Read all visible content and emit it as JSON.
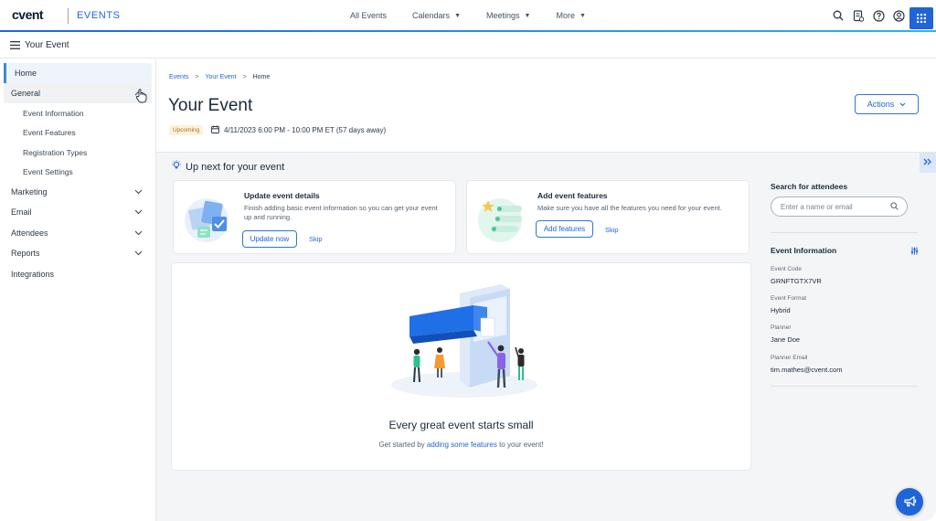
{
  "app": {
    "brand": "cvent",
    "product": "EVENTS"
  },
  "topnav": {
    "links": [
      {
        "label": "All Events",
        "dropdown": false
      },
      {
        "label": "Calendars",
        "dropdown": true
      },
      {
        "label": "Meetings",
        "dropdown": true
      },
      {
        "label": "More",
        "dropdown": true
      }
    ],
    "icons": [
      "search-icon",
      "document-icon",
      "help-icon",
      "user-icon",
      "app-grid-icon"
    ]
  },
  "subheader": {
    "title": "Your Event"
  },
  "sidebar": {
    "items": [
      {
        "label": "Home",
        "active": true
      },
      {
        "label": "General",
        "expanded": true
      },
      {
        "label": "Marketing",
        "expandable": true
      },
      {
        "label": "Email",
        "expandable": true
      },
      {
        "label": "Attendees",
        "expandable": true
      },
      {
        "label": "Reports",
        "expandable": true
      },
      {
        "label": "Integrations"
      }
    ],
    "general_children": [
      "Event Information",
      "Event Features",
      "Registration Types",
      "Event Settings"
    ]
  },
  "breadcrumb": {
    "items": [
      "Events",
      "Your Event",
      "Home"
    ]
  },
  "event": {
    "title": "Your Event",
    "status": "Upcoming",
    "datetime": "4/11/2023 6:00 PM - 10:00 PM ET (57 days away)"
  },
  "actions": {
    "label": "Actions"
  },
  "upnext": {
    "title": "Up next for your event"
  },
  "cards": [
    {
      "title": "Update event details",
      "description": "Finish adding basic event information so you can get your event up and running.",
      "button": "Update now",
      "skip": "Skip"
    },
    {
      "title": "Add event features",
      "description": "Make sure you have all the features you need for your event.",
      "button": "Add features",
      "skip": "Skip"
    }
  ],
  "empty_state": {
    "title": "Every great event starts small",
    "sub_before": "Get started by ",
    "sub_link": "adding some features",
    "sub_after": " to your event!"
  },
  "right_panel": {
    "search_label": "Search for attendees",
    "search_placeholder": "Enter a name or email",
    "info_title": "Event Information",
    "fields": [
      {
        "label": "Event Code",
        "value": "GRNFTGTX7VR"
      },
      {
        "label": "Event Format",
        "value": "Hybrid"
      },
      {
        "label": "Planner",
        "value": "Jane Doe"
      },
      {
        "label": "Planner Email",
        "value": "tim.mathes@cvent.com"
      }
    ]
  },
  "colors": {
    "accent": "#1f64d8",
    "badge_bg": "#fdf1df",
    "badge_text": "#b27111"
  }
}
